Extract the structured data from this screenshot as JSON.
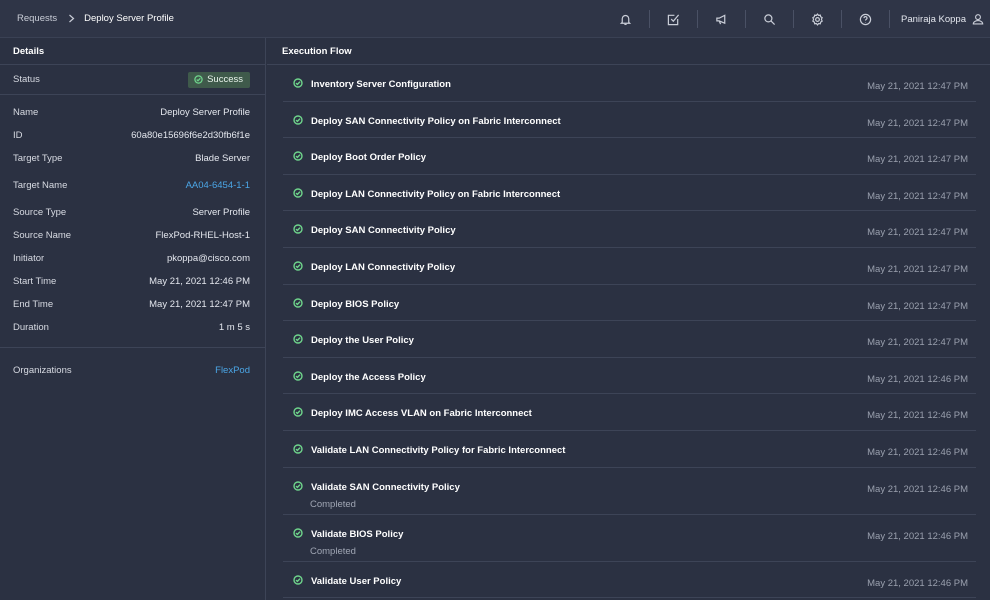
{
  "header": {
    "breadcrumb_root": "Requests",
    "breadcrumb_current": "Deploy Server Profile",
    "user_name": "Paniraja Koppa",
    "tools": [
      {
        "name": "bell-icon"
      },
      {
        "name": "task-check-icon"
      },
      {
        "name": "megaphone-icon"
      },
      {
        "name": "search-icon"
      },
      {
        "name": "gear-icon"
      },
      {
        "name": "help-icon"
      }
    ]
  },
  "details": {
    "title": "Details",
    "status_label": "Status",
    "status_value": "Success",
    "fields": [
      {
        "label": "Name",
        "value": "Deploy Server Profile"
      },
      {
        "label": "ID",
        "value": "60a80e15696f6e2d30fb6f1e"
      },
      {
        "label": "Target Type",
        "value": "Blade Server"
      },
      {
        "label": "Target Name",
        "value": "AA04-6454-1-1",
        "link": true
      },
      {
        "label": "Source Type",
        "value": "Server Profile"
      },
      {
        "label": "Source Name",
        "value": "FlexPod-RHEL-Host-1"
      },
      {
        "label": "Initiator",
        "value": "pkoppa@cisco.com"
      },
      {
        "label": "Start Time",
        "value": "May 21, 2021 12:46 PM"
      },
      {
        "label": "End Time",
        "value": "May 21, 2021 12:47 PM"
      },
      {
        "label": "Duration",
        "value": "1 m 5 s"
      }
    ],
    "org_label": "Organizations",
    "org_value": "FlexPod"
  },
  "flow": {
    "title": "Execution Flow",
    "steps": [
      {
        "name": "Inventory Server Configuration",
        "time": "May 21, 2021 12:47 PM"
      },
      {
        "name": "Deploy SAN Connectivity Policy on Fabric Interconnect",
        "time": "May 21, 2021 12:47 PM"
      },
      {
        "name": "Deploy Boot Order Policy",
        "time": "May 21, 2021 12:47 PM"
      },
      {
        "name": "Deploy LAN Connectivity Policy on Fabric Interconnect",
        "time": "May 21, 2021 12:47 PM"
      },
      {
        "name": "Deploy SAN Connectivity Policy",
        "time": "May 21, 2021 12:47 PM"
      },
      {
        "name": "Deploy LAN Connectivity Policy",
        "time": "May 21, 2021 12:47 PM"
      },
      {
        "name": "Deploy BIOS Policy",
        "time": "May 21, 2021 12:47 PM"
      },
      {
        "name": "Deploy the User Policy",
        "time": "May 21, 2021 12:47 PM"
      },
      {
        "name": "Deploy the Access Policy",
        "time": "May 21, 2021 12:46 PM"
      },
      {
        "name": "Deploy IMC Access VLAN on Fabric Interconnect",
        "time": "May 21, 2021 12:46 PM"
      },
      {
        "name": "Validate LAN Connectivity Policy for Fabric Interconnect",
        "time": "May 21, 2021 12:46 PM"
      },
      {
        "name": "Validate SAN Connectivity Policy",
        "time": "May 21, 2021 12:46 PM",
        "sub": "Completed"
      },
      {
        "name": "Validate BIOS Policy",
        "time": "May 21, 2021 12:46 PM",
        "sub": "Completed"
      },
      {
        "name": "Validate User Policy",
        "time": "May 21, 2021 12:46 PM"
      }
    ]
  },
  "colors": {
    "background": "#2b3142",
    "success": "#6fd58c",
    "link": "#4ba6e6"
  }
}
